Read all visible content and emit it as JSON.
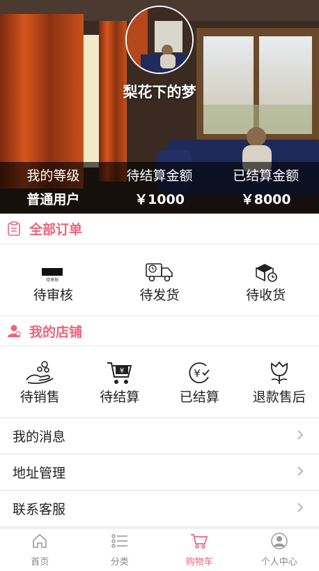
{
  "profile": {
    "username": "梨花下的梦"
  },
  "stats": [
    {
      "label": "我的等级",
      "value": "普通用户"
    },
    {
      "label": "待结算金额",
      "value": "￥1000"
    },
    {
      "label": "已结算金额",
      "value": "￥8000"
    }
  ],
  "orders": {
    "title": "全部订单",
    "icon": "clipboard-icon",
    "items": [
      {
        "label": "待审核",
        "icon": "pending-review-icon",
        "icon_text": "待审核"
      },
      {
        "label": "待发货",
        "icon": "delivery-truck-icon"
      },
      {
        "label": "待收货",
        "icon": "package-clock-icon"
      }
    ]
  },
  "shop": {
    "title": "我的店铺",
    "icon": "user-shop-icon",
    "items": [
      {
        "label": "待销售",
        "icon": "hand-coins-icon"
      },
      {
        "label": "待结算",
        "icon": "cart-yen-icon",
        "icon_text": "¥"
      },
      {
        "label": "已结算",
        "icon": "yen-check-icon",
        "icon_text": "¥"
      },
      {
        "label": "退款售后",
        "icon": "flower-icon"
      }
    ]
  },
  "menu": [
    {
      "label": "我的消息"
    },
    {
      "label": "地址管理"
    },
    {
      "label": "联系客服"
    }
  ],
  "tabbar": [
    {
      "label": "首页",
      "icon": "home-icon",
      "active": false
    },
    {
      "label": "分类",
      "icon": "list-icon",
      "active": false
    },
    {
      "label": "购物车",
      "icon": "cart-icon",
      "active": true
    },
    {
      "label": "个人中心",
      "icon": "user-icon",
      "active": false
    }
  ],
  "colors": {
    "accent": "#f0627a",
    "text": "#222222",
    "divider": "#e4e4e4",
    "tab_inactive": "#888888"
  }
}
